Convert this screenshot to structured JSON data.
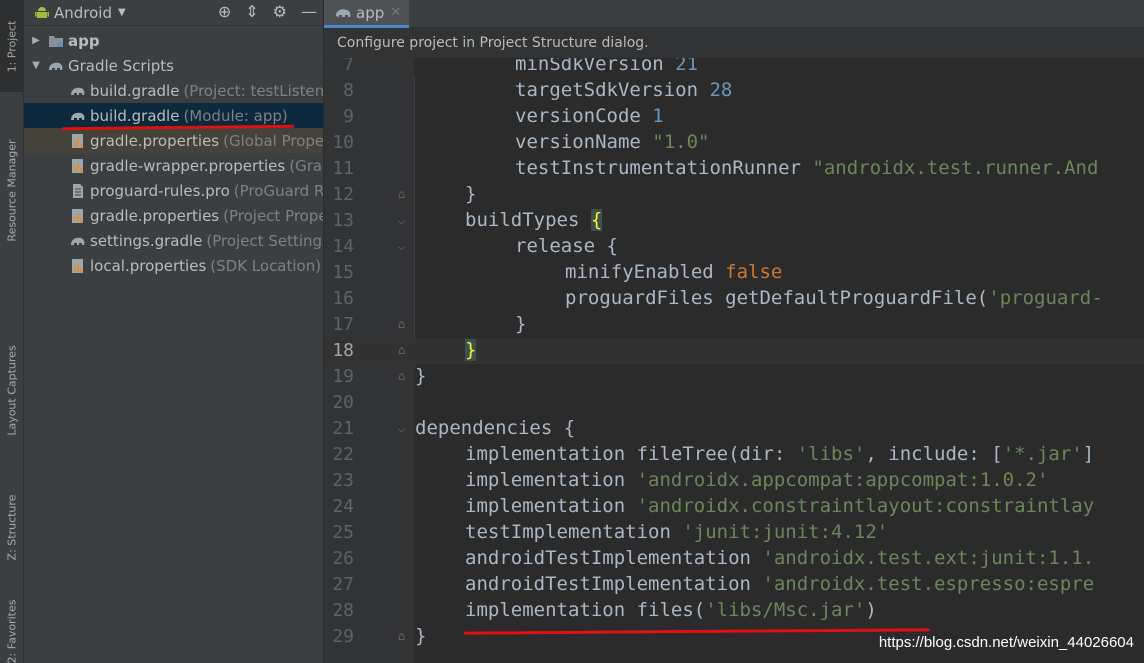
{
  "toolstrip": {
    "tabs": [
      "1: Project",
      "Resource Manager",
      "Layout Captures",
      "Z: Structure",
      "2: Favorites"
    ]
  },
  "project": {
    "view_title": "Android",
    "tree": [
      {
        "name": "app",
        "hint": "",
        "bold": true,
        "arrow": "▶",
        "indent": 0
      },
      {
        "name": "Gradle Scripts",
        "hint": "",
        "bold": false,
        "arrow": "▼",
        "indent": 0
      },
      {
        "name": "build.gradle",
        "hint": "(Project: testListener",
        "indent": 1
      },
      {
        "name": "build.gradle",
        "hint": "(Module: app)",
        "indent": 1
      },
      {
        "name": "gradle.properties",
        "hint": "(Global Propert",
        "indent": 1
      },
      {
        "name": "gradle-wrapper.properties",
        "hint": "(Gradl",
        "indent": 1
      },
      {
        "name": "proguard-rules.pro",
        "hint": "(ProGuard Ru",
        "indent": 1
      },
      {
        "name": "gradle.properties",
        "hint": "(Project Proper",
        "indent": 1
      },
      {
        "name": "settings.gradle",
        "hint": "(Project Settings)",
        "indent": 1
      },
      {
        "name": "local.properties",
        "hint": "(SDK Location)",
        "indent": 1
      }
    ]
  },
  "editor": {
    "tab_label": "app",
    "banner": "Configure project in Project Structure dialog.",
    "line_numbers": [
      "7",
      "8",
      "9",
      "10",
      "11",
      "12",
      "13",
      "14",
      "15",
      "16",
      "17",
      "18",
      "19",
      "20",
      "21",
      "22",
      "23",
      "24",
      "25",
      "26",
      "27",
      "28",
      "29"
    ]
  },
  "code": {
    "l7": "minSdkVersion ",
    "l7n": "21",
    "l8": "targetSdkVersion ",
    "l8n": "28",
    "l9": "versionCode ",
    "l9n": "1",
    "l10": "versionName ",
    "l10s": "\"1.0\"",
    "l11": "testInstrumentationRunner ",
    "l11s": "\"androidx.test.runner.And",
    "l12": "}",
    "l13": "buildTypes ",
    "l13b": "{",
    "l14": "release {",
    "l15": "minifyEnabled ",
    "l15k": "false",
    "l16": "proguardFiles getDefaultProguardFile(",
    "l16s": "'proguard-",
    "l17": "}",
    "l18b": "}",
    "l19": "}",
    "l21": "dependencies {",
    "l22": "implementation fileTree(dir: ",
    "l22s1": "'libs'",
    "l22m": ", include: [",
    "l22s2": "'*.jar'",
    "l22e": "]",
    "l23": "implementation ",
    "l23s": "'androidx.appcompat:appcompat:1.0.2'",
    "l24": "implementation ",
    "l24s": "'androidx.constraintlayout:constraintlay",
    "l25": "testImplementation ",
    "l25s": "'junit:junit:4.12'",
    "l26": "androidTestImplementation ",
    "l26s": "'androidx.test.ext:junit:1.1.",
    "l27": "androidTestImplementation ",
    "l27s": "'androidx.test.espresso:espre",
    "l28": "implementation files(",
    "l28s": "'libs/Msc.jar'",
    "l28e": ")",
    "l29": "}"
  },
  "watermark": "https://blog.csdn.net/weixin_44026604",
  "colors": {
    "accent": "#4a88c7",
    "annotation_red": "#e01010",
    "keyword": "#cc7832",
    "string": "#6a8759",
    "number": "#6897bb"
  }
}
